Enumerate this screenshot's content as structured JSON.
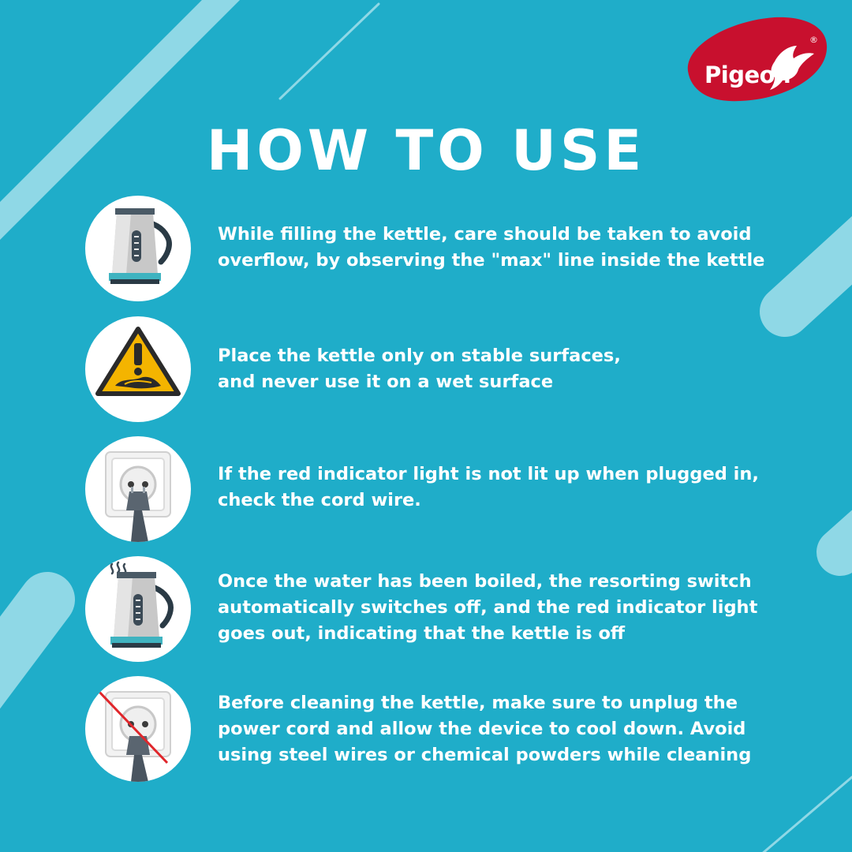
{
  "brand": {
    "name": "Pigeon",
    "registered_mark": "®",
    "colors": {
      "background": "#1fadc9",
      "logo_red": "#c8102e",
      "stripe": "#8fd8e6"
    }
  },
  "title": "HOW TO USE",
  "steps": [
    {
      "icon": "kettle-icon",
      "text": "While filling the kettle, care should be taken to avoid\noverflow, by observing the \"max\" line inside the kettle"
    },
    {
      "icon": "warning-wet-surface-icon",
      "text": "Place the kettle only on stable surfaces,\nand never use it on a wet surface"
    },
    {
      "icon": "power-socket-plug-icon",
      "text": "If the red indicator light is not lit up when plugged in,\ncheck the cord wire."
    },
    {
      "icon": "boiling-kettle-icon",
      "text": "Once the water has been boiled, the resorting switch\nautomatically switches off, and the red indicator light\ngoes out, indicating that the kettle is off"
    },
    {
      "icon": "unplug-socket-icon",
      "text": "Before cleaning the kettle, make sure to unplug the\npower cord and allow the device to cool down. Avoid\nusing steel wires or chemical powders while cleaning"
    }
  ]
}
